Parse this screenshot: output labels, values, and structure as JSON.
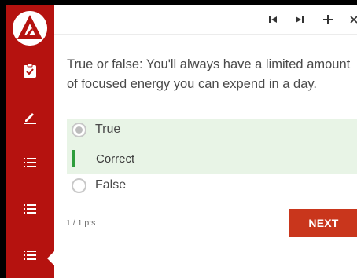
{
  "sidebar": {
    "logo": "triangle-logo",
    "items": [
      {
        "icon": "clipboard-check-icon"
      },
      {
        "icon": "pencil-icon"
      },
      {
        "icon": "list-icon"
      },
      {
        "icon": "list-icon"
      },
      {
        "icon": "list-icon",
        "active": true
      }
    ]
  },
  "toolbar": {
    "buttons": [
      "skip-previous-icon",
      "skip-next-icon",
      "plus-icon",
      "close-icon"
    ]
  },
  "quiz": {
    "question": "True or false: You'll always have a limited amount of focused energy you can expend in a day.",
    "options": [
      {
        "label": "True",
        "selected": true
      },
      {
        "label": "False",
        "selected": false
      }
    ],
    "feedback": "Correct",
    "score": "1 / 1 pts",
    "next_label": "NEXT"
  },
  "colors": {
    "sidebar": "#b5120f",
    "next_button": "#c9361c",
    "correct_bg": "#e8f4e6",
    "correct_bar": "#2e9d3c"
  }
}
